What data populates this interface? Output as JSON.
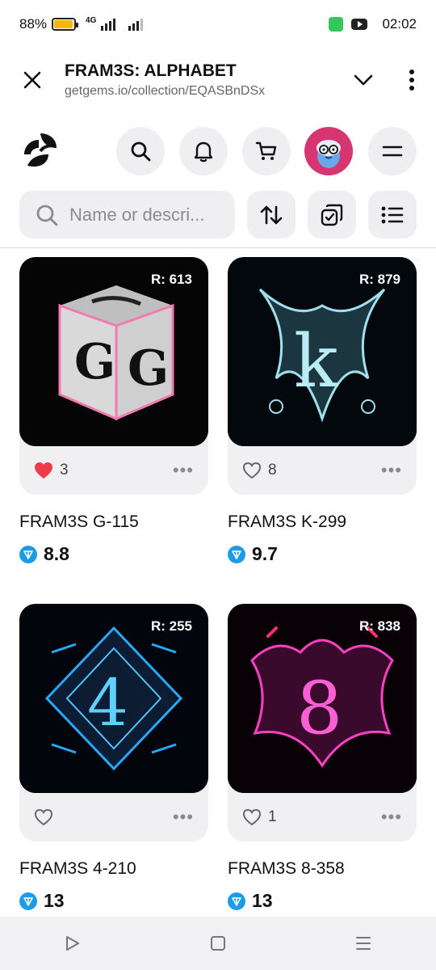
{
  "status_bar": {
    "battery_percent": "88%",
    "battery_level": 0.88,
    "network": "4G",
    "time": "02:02"
  },
  "url_bar": {
    "title": "FRAM3S: ALPHABET",
    "url": "getgems.io/collection/EQASBnDSx"
  },
  "search": {
    "placeholder": "Name or descri..."
  },
  "icons": {
    "close": "close-icon",
    "chevron": "chevron-down-icon",
    "more": "more-vertical-icon",
    "search": "search-icon",
    "bell": "bell-icon",
    "cart": "cart-icon",
    "menu": "menu-icon",
    "sort": "sort-icon",
    "select": "select-icon",
    "list": "list-view-icon"
  },
  "colors": {
    "accent_pink": "#d6356f",
    "ton_blue": "#1b9be8",
    "liked_red": "#ef3b4a"
  },
  "items": [
    {
      "rank": "R: 613",
      "likes": "3",
      "liked": true,
      "name": "FRAM3S G-115",
      "price": "8.8"
    },
    {
      "rank": "R: 879",
      "likes": "8",
      "liked": false,
      "name": "FRAM3S K-299",
      "price": "9.7"
    },
    {
      "rank": "R: 255",
      "likes": "",
      "liked": false,
      "name": "FRAM3S 4-210",
      "price": "13"
    },
    {
      "rank": "R: 838",
      "likes": "1",
      "liked": false,
      "name": "FRAM3S 8-358",
      "price": "13"
    }
  ]
}
